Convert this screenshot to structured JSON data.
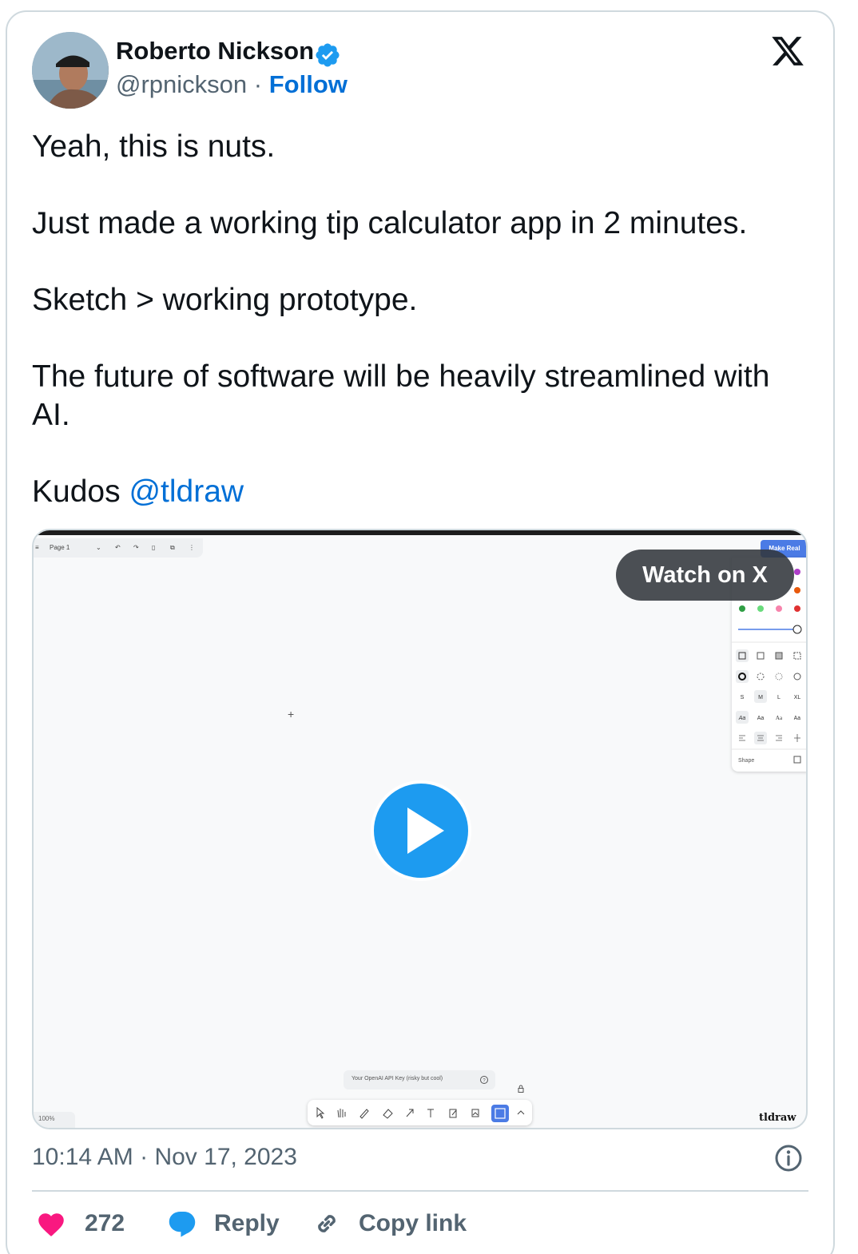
{
  "author": {
    "name": "Roberto Nickson",
    "handle": "@rpnickson",
    "separator": "·",
    "follow_label": "Follow"
  },
  "tweet": {
    "lines": [
      "Yeah, this is nuts.",
      "Just made a working tip calculator app in 2 minutes.",
      "Sketch > working prototype.",
      "The future of software will be heavily streamlined with AI."
    ],
    "kudos_prefix": "Kudos",
    "mention": "@tldraw"
  },
  "media": {
    "watch_label": "Watch on X",
    "app": {
      "page_label": "Page 1",
      "make_real_label": "Make Real",
      "api_placeholder": "Your OpenAI API Key (risky but cool)",
      "zoom_label": "100%",
      "watermark": "tldraw",
      "size_labels": [
        "S",
        "M",
        "L",
        "XL"
      ],
      "font_labels": [
        "Aa",
        "Aa",
        "Aa",
        "Aa"
      ],
      "shape_label": "Shape"
    }
  },
  "footer": {
    "time": "10:14 AM",
    "date": "Nov 17, 2023",
    "like_count": "272",
    "reply_label": "Reply",
    "copy_label": "Copy link"
  },
  "colors": {
    "link": "#006fd6",
    "like": "#f91880",
    "reply": "#1d9bf0",
    "play": "#1d9bf0"
  }
}
